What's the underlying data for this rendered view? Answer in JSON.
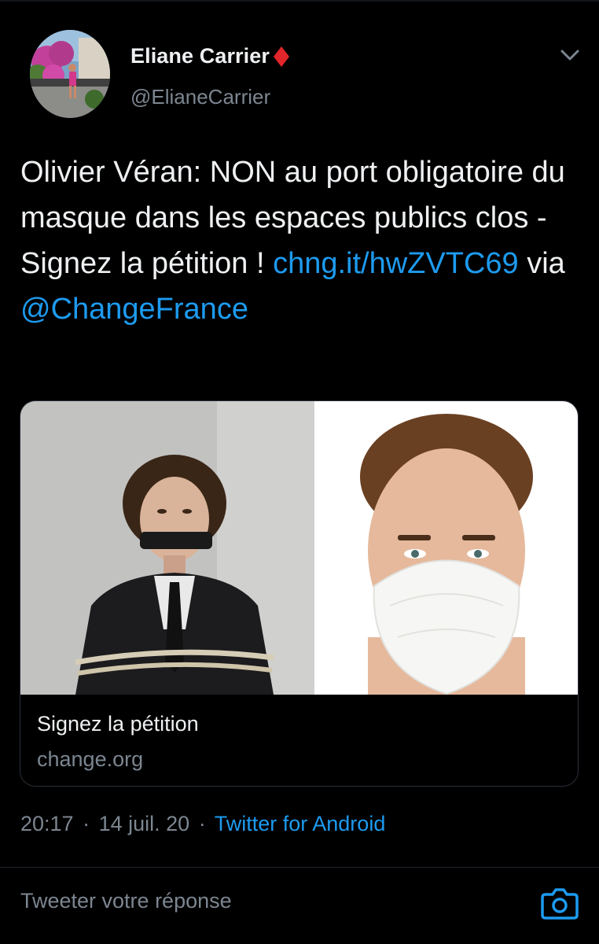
{
  "tweet": {
    "author": {
      "display_name": "Eliane Carrier",
      "handle": "@ElianeCarrier",
      "badge_icon": "red-diamond-icon",
      "badge_color": "#e0262a"
    },
    "menu_icon": "chevron-down-icon",
    "text_plain": "Olivier Véran: NON au port obligatoire du masque dans les espaces publics clos - Signez la pétition ! ",
    "link_text": "chng.it/hwZVTC69",
    "via_text": " via ",
    "mention_text": "@ChangeFrance",
    "link_color": "#1d9bf0"
  },
  "card": {
    "title": "Signez la pétition",
    "domain": "change.org"
  },
  "meta": {
    "time": "20:17",
    "separator": "·",
    "date": "14 juil. 20",
    "source": "Twitter for Android"
  },
  "reply": {
    "placeholder": "Tweeter votre réponse",
    "camera_icon": "camera-icon"
  }
}
